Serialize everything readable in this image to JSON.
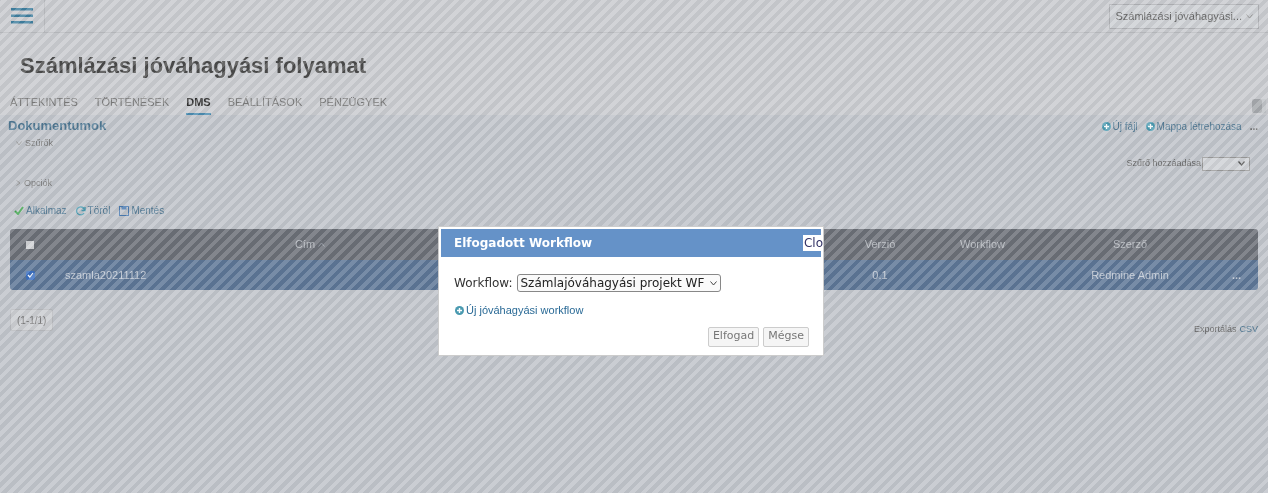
{
  "top_bar": {
    "project_select": "Számlázási jóváhagyási..."
  },
  "title": "Számlázási jóváhagyási folyamat",
  "tabs": [
    {
      "label": "ÁTTEKINTÉS",
      "selected": false
    },
    {
      "label": "TÖRTÉNÉSEK",
      "selected": false
    },
    {
      "label": "DMS",
      "selected": true
    },
    {
      "label": "BEÁLLÍTÁSOK",
      "selected": false
    },
    {
      "label": "PÉNZÜGYEK",
      "selected": false
    }
  ],
  "documents": {
    "heading": "Dokumentumok",
    "actions": [
      "Új fájl",
      "Mappa létrehozása"
    ],
    "more": "...",
    "filters": {
      "label": "Szűrők",
      "expanded": true
    },
    "options": {
      "label": "Opciók",
      "expanded": false
    },
    "add_filter_label": "Szűrő hozzáadása",
    "buttons": [
      {
        "kind": "apply",
        "label": "Alkalmaz"
      },
      {
        "kind": "clear",
        "label": "Töröl"
      },
      {
        "kind": "save",
        "label": "Mentés"
      }
    ]
  },
  "table": {
    "columns": [
      {
        "label": "Cím",
        "sorted": true
      },
      {
        "label": "Verzió",
        "sorted": false
      },
      {
        "label": "Workflow",
        "sorted": false
      },
      {
        "label": "Szerző",
        "sorted": false
      }
    ],
    "header_checked": false,
    "rows": [
      {
        "selected": true,
        "checked": true,
        "title": "szamla20211112",
        "version": "0.1",
        "author": "Redmine Admin",
        "menu": "..."
      }
    ]
  },
  "pagination": "(1-1/1)",
  "export": {
    "label": "Exportálás",
    "link": "CSV"
  },
  "dialog": {
    "title": "Elfogadott Workflow",
    "close_label": "Clo",
    "field_label": "Workflow:",
    "field_value": "Számlajóváhagyási projekt WF",
    "link": "Új jóváhagyási workflow",
    "buttons": [
      "Elfogad",
      "Mégse"
    ]
  }
}
